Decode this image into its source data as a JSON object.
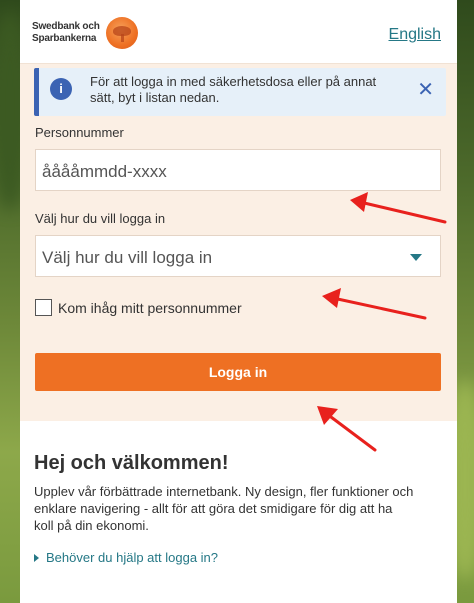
{
  "brand": {
    "logo_text_line1": "Swedbank och",
    "logo_text_line2": "Sparbankerna"
  },
  "header": {
    "language_link": "English"
  },
  "info_banner": {
    "icon": "info-icon",
    "text": "För att logga in med säkerhetsdosa eller på annat sätt, byt i listan nedan.",
    "close": "✕"
  },
  "form": {
    "personnummer_label": "Personnummer",
    "personnummer_placeholder": "ååååmmdd-xxxx",
    "method_label": "Välj hur du vill logga in",
    "method_selected": "Välj hur du vill logga in",
    "remember_label": "Kom ihåg mitt personnummer",
    "submit_label": "Logga in"
  },
  "welcome": {
    "title": "Hej och välkommen!",
    "body": "Upplev vår förbättrade internetbank. Ny design, fler funktioner och enklare navigering - allt för att göra det smidigare för dig att ha koll på din ekonomi.",
    "help_link": "Behöver du hjälp att logga in?"
  },
  "colors": {
    "accent_orange": "#ee7023",
    "link_teal": "#257886",
    "info_blue": "#3b63b3",
    "annotation_red": "#e8211d"
  }
}
